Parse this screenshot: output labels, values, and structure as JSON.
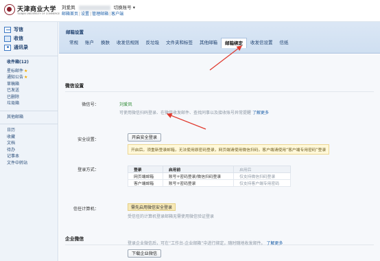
{
  "header": {
    "logo_text": "天津商业大学",
    "logo_sub": "TIANJIN UNIVERSITY OF COMMERCE",
    "user_name": "刘爱凤",
    "switch_label": "切换账号",
    "links": [
      "邮箱首页",
      "设置",
      "管理邮箱",
      "客户端"
    ]
  },
  "sidebar": {
    "buttons": [
      {
        "label": "写信",
        "icon": "write-icon"
      },
      {
        "label": "收信",
        "icon": "inbox-icon"
      },
      {
        "label": "通讯录",
        "icon": "contacts-icon"
      }
    ],
    "inbox_label": "收件箱(12)",
    "folders": [
      "星标邮件",
      "通知公告",
      "草稿箱",
      "已发送",
      "已删除",
      "垃圾箱"
    ],
    "other_label": "其他邮箱",
    "apps": [
      "日历",
      "收藏",
      "文档",
      "待办",
      "记事本",
      "文件中转站"
    ]
  },
  "main": {
    "title": "邮箱设置",
    "tabs": [
      "常规",
      "账户",
      "换肤",
      "收发信规则",
      "反垃圾",
      "文件夹和标签",
      "其他邮箱",
      "邮箱绑定",
      "收发信设置",
      "信纸"
    ],
    "active_tab": 7
  },
  "wechat": {
    "title": "微信设置",
    "wechat_label": "微信号：",
    "wechat_value": "刘爱凤",
    "wechat_hint": "可使用微信扫码登录、在微信收发邮件、查找同事以及接收账号异常提醒",
    "learn_more": "了解更多",
    "security_label": "安全设置：",
    "security_button": "开启安全登录",
    "warning_text": "开启后，须重新登录邮箱，无法使用原密码登录，网页端请使用微信扫码，客户端请使用“客户端专用密码”登录",
    "login_label": "登录方式：",
    "table": {
      "headers": [
        "登录",
        "启用前",
        "启用后"
      ],
      "rows": [
        [
          "网页端邮箱",
          "账号+密码登录/微信扫码登录",
          "仅支持微信扫码登录"
        ],
        [
          "客户端邮箱",
          "账号+密码登录",
          "仅支持客户端专用密码"
        ]
      ]
    },
    "trusted_label": "信任计算机：",
    "trusted_button": "需先启用微信安全登录",
    "trusted_hint": "受信任的计算机登录邮箱无需使用微信验证登录"
  },
  "enterprise": {
    "title": "企业微信",
    "download_button": "下载企业微信",
    "hint": "登录企业微信后，可在“工作台-企业邮箱”中进行绑定，随时随地收发邮件。",
    "learn_more": "了解更多"
  },
  "colors": {
    "accent_red": "#e03a2f",
    "link_blue": "#1a5ea8",
    "sidebar_bg": "#eef3f9",
    "tab_bar": "#cfdff1"
  }
}
